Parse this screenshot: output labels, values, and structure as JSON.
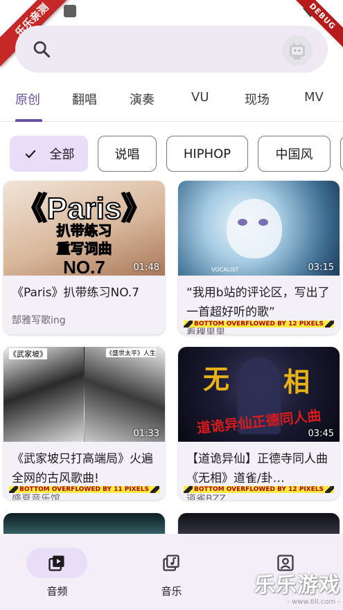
{
  "badge": {
    "corner_label": "乐乐亲测",
    "debug_label": "DEBUG"
  },
  "search": {
    "icon": "search-icon",
    "avatar_icon": "bilibili-tv-icon"
  },
  "tabs": [
    {
      "label": "原创",
      "active": true
    },
    {
      "label": "翻唱"
    },
    {
      "label": "演奏"
    },
    {
      "label": "VU"
    },
    {
      "label": "现场"
    },
    {
      "label": "MV"
    }
  ],
  "chips": [
    {
      "label": "全部",
      "selected": true
    },
    {
      "label": "说唱"
    },
    {
      "label": "HIPHOP"
    },
    {
      "label": "中国风"
    }
  ],
  "cards": [
    {
      "thumb_text_1": "《Paris》",
      "thumb_text_2": "扒带练习",
      "thumb_text_3": "重写词曲",
      "thumb_text_4": "NO.7",
      "duration": "01:48",
      "title": "《Paris》扒带练习NO.7",
      "subtitle": "郜雅写歌ing"
    },
    {
      "thumb_text_1": "VOCALIST",
      "duration": "03:15",
      "title": "“我用b站的评论区，写出了一首超好听的歌”",
      "subtitle": "看稞里里",
      "overflow": "BOTTOM OVERFLOWED BY 12 PIXELS"
    },
    {
      "thumb_text_1": "《武家坡》",
      "thumb_text_2": "《盛世太平》人生",
      "duration": "01:33",
      "title": "《武家坡只打高端局》火遍全网的古风歌曲!",
      "subtitle": "盛夏音乐馆",
      "overflow": "BOTTOM OVERFLOWED BY 11 PIXELS"
    },
    {
      "thumb_text_1": "无",
      "thumb_text_2": "相",
      "thumb_text_3": "道诡异仙正德同人曲",
      "duration": "03:45",
      "title": "【道诡异仙】正德寺同人曲《无相》道雀/卦…",
      "subtitle": "道雀BZZ",
      "overflow": "BOTTOM OVERFLOWED BY 12 PIXELS"
    }
  ],
  "bottom_nav": [
    {
      "label": "音频",
      "icon": "audio-video-icon",
      "active": true
    },
    {
      "label": "音乐",
      "icon": "music-note-icon"
    },
    {
      "label": "",
      "icon": "profile-icon"
    }
  ],
  "watermark": {
    "title": "乐乐游戏",
    "url": "- www.6ll.com -"
  },
  "colors": {
    "accent": "#6750a4",
    "chip_selected": "#e8def8",
    "card_bg": "#f4f0f7",
    "nav_bg": "#f3eef8"
  }
}
